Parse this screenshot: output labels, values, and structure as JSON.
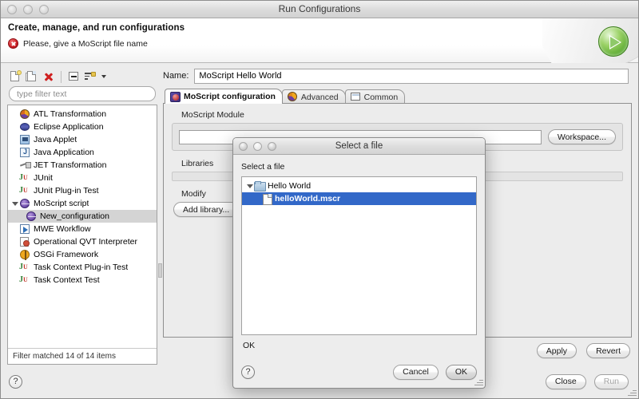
{
  "window": {
    "title": "Run Configurations",
    "header_title": "Create, manage, and run configurations",
    "header_message": "Please, give a MoScript file name",
    "error_icon": "error-icon",
    "run_icon": "run-arrow-icon"
  },
  "sidebar": {
    "toolbar": [
      {
        "name": "new-configuration-icon",
        "label": "New"
      },
      {
        "name": "duplicate-configuration-icon",
        "label": "Duplicate"
      },
      {
        "name": "delete-configuration-icon",
        "label": "Delete"
      },
      {
        "name": "collapse-all-icon",
        "label": "Collapse All"
      },
      {
        "name": "filter-configurations-icon",
        "label": "Filter"
      }
    ],
    "filter_placeholder": "type filter text",
    "items": [
      {
        "label": "ATL Transformation",
        "icon": "atl-icon",
        "indent": 0,
        "expandable": false,
        "selected": false
      },
      {
        "label": "Eclipse Application",
        "icon": "eclipse-icon",
        "indent": 0,
        "expandable": false,
        "selected": false
      },
      {
        "label": "Java Applet",
        "icon": "java-applet-icon",
        "indent": 0,
        "expandable": false,
        "selected": false
      },
      {
        "label": "Java Application",
        "icon": "java-application-icon",
        "indent": 0,
        "expandable": false,
        "selected": false
      },
      {
        "label": "JET Transformation",
        "icon": "jet-icon",
        "indent": 0,
        "expandable": false,
        "selected": false
      },
      {
        "label": "JUnit",
        "icon": "junit-icon",
        "indent": 0,
        "expandable": false,
        "selected": false
      },
      {
        "label": "JUnit Plug-in Test",
        "icon": "junit-plugin-icon",
        "indent": 0,
        "expandable": false,
        "selected": false
      },
      {
        "label": "MoScript script",
        "icon": "moscript-icon",
        "indent": 0,
        "expandable": true,
        "selected": false
      },
      {
        "label": "New_configuration",
        "icon": "moscript-icon",
        "indent": 1,
        "expandable": false,
        "selected": true
      },
      {
        "label": "MWE Workflow",
        "icon": "mwe-icon",
        "indent": 0,
        "expandable": false,
        "selected": false
      },
      {
        "label": "Operational QVT Interpreter",
        "icon": "qvt-icon",
        "indent": 0,
        "expandable": false,
        "selected": false
      },
      {
        "label": "OSGi Framework",
        "icon": "osgi-icon",
        "indent": 0,
        "expandable": false,
        "selected": false
      },
      {
        "label": "Task Context Plug-in Test",
        "icon": "junit-plugin-icon",
        "indent": 0,
        "expandable": false,
        "selected": false
      },
      {
        "label": "Task Context Test",
        "icon": "junit-icon",
        "indent": 0,
        "expandable": false,
        "selected": false
      }
    ],
    "filter_status": "Filter matched 14 of 14 items"
  },
  "main": {
    "name_label": "Name:",
    "name_value": "MoScript Hello World",
    "tabs": [
      {
        "label": "MoScript configuration",
        "icon": "moscript-tab-icon",
        "active": true
      },
      {
        "label": "Advanced",
        "icon": "advanced-tab-icon",
        "active": false
      },
      {
        "label": "Common",
        "icon": "common-tab-icon",
        "active": false
      }
    ],
    "module_group_label": "MoScript Module",
    "module_value": "",
    "workspace_button": "Workspace...",
    "libraries_label": "Libraries",
    "modify_label": "Modify",
    "add_library_button": "Add library...",
    "apply_button": "Apply",
    "revert_button": "Revert"
  },
  "footer": {
    "help_icon": "help-icon",
    "help_glyph": "?",
    "close_button": "Close",
    "run_button": "Run",
    "run_disabled": true
  },
  "dialog": {
    "title": "Select a file",
    "prompt": "Select a file",
    "tree": [
      {
        "label": "Hello World",
        "icon": "folder-icon",
        "indent": 0,
        "expandable": true,
        "selected": false
      },
      {
        "label": "helloWorld.mscr",
        "icon": "file-icon",
        "indent": 1,
        "expandable": false,
        "selected": true
      }
    ],
    "status": "OK",
    "help_glyph": "?",
    "cancel_button": "Cancel",
    "ok_button": "OK",
    "selection_color": "#3268c8"
  }
}
